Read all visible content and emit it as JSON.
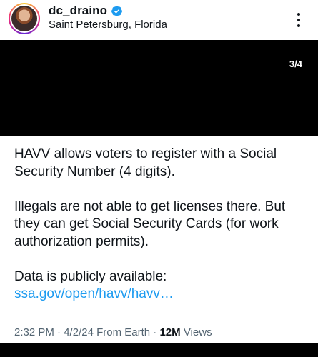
{
  "header": {
    "username": "dc_draino",
    "location": "Saint Petersburg, Florida",
    "verified_color": "#1d9bf0"
  },
  "media": {
    "counter": "3/4"
  },
  "tweet": {
    "paragraph_1": "HAVV allows voters to register with a Social Security Number (4 digits).",
    "paragraph_2": "Illegals are not able to get licenses there. But they can get Social Security Cards (for work authorization permits).",
    "paragraph_3_prefix": "Data is publicly available: ",
    "link_text": "ssa.gov/open/havv/havv…"
  },
  "meta": {
    "time": "2:32 PM",
    "separator": " · ",
    "date": "4/2/24",
    "source": "From Earth",
    "views_count": "12M",
    "views_label": "Views"
  },
  "colors": {
    "link": "#1d9bf0",
    "text": "#0f1419",
    "muted": "#536471"
  }
}
